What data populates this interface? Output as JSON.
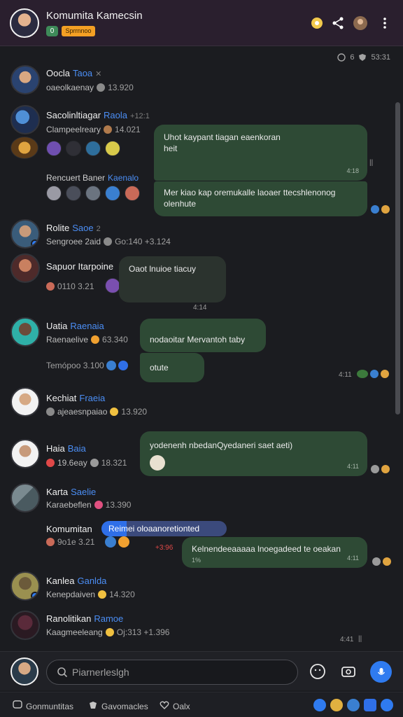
{
  "header": {
    "title": "Komumita Kamecsin",
    "level": "0",
    "badge": "Sprrnnoo"
  },
  "status": {
    "time": "53:31",
    "glyphs": "6"
  },
  "messages": [
    {
      "name": "Oocla",
      "role": "Taoa",
      "extra": "✕",
      "meta_text": "oaeolkaenay",
      "meta_num": "13.920"
    },
    {
      "name": "Sacolinltiagar",
      "role": "Raola",
      "extra": "+12:1",
      "meta_text": "Clampeelreary",
      "meta_num": "14.021"
    },
    {
      "name": "Rolite",
      "role": "Saoe",
      "extra": "2",
      "meta_text": "Sengroee 2aid",
      "meta_num": "Go:140 +3.124"
    },
    {
      "name": "Sapuor Itarpoine",
      "role": "",
      "extra": "",
      "meta_text": "",
      "meta_num": "0110 3.21"
    },
    {
      "name": "Uatia",
      "role": "Raenaia",
      "extra": "",
      "meta_text": "Raenaelive",
      "meta_num": "63.340"
    },
    {
      "name": "Kechiat",
      "role": "Fraeia",
      "extra": "",
      "meta_text": "ajeaesnpaiao",
      "meta_num": "13.920"
    },
    {
      "name": "Haia",
      "role": "Baia",
      "extra": "",
      "meta_text": "19.6eay",
      "meta_num": "18.321"
    },
    {
      "name": "Karta",
      "role": "Saelie",
      "extra": "",
      "meta_text": "Karaebeflen",
      "meta_num": "13.390"
    },
    {
      "name": "Komumitan",
      "role": "",
      "extra": "",
      "meta_text": "",
      "meta_num": "9o1e 3.21"
    },
    {
      "name": "Kanlea",
      "role": "Ganlda",
      "extra": "",
      "meta_text": "Kenepdaiven",
      "meta_num": "14.320"
    },
    {
      "name": "Ranolitikan",
      "role": "Ramoe",
      "extra": "",
      "meta_text": "Kaagmeeleang",
      "meta_num": "Oj:313 +1.396"
    }
  ],
  "sub_label": "Rencuert Baner",
  "sub_role": "Kaenalo",
  "bubbles": {
    "b1_text": "Uhot kaypant tiagan eaenkoran",
    "b1_text2": "heit",
    "b1_time": "4:18",
    "b2_text": "Mer kiao kap oremukalle laoaer ttecshlenonog",
    "b2_text2": "olenhute",
    "b3_text": "Oaot lnuioe tiacuy",
    "b3_time": "4:14",
    "b4_text": "nodaoitar Mervantoh taby",
    "b5_text": "otute",
    "b5_time": "4:11",
    "b6_text": "yodenenh nbedanQyedaneri saet aeti)",
    "b6_time": "4:11",
    "pill_text": "Reimei oloaanoretionted",
    "b7_text": "Kelnendeeaaaaa lnoegadeed te oeakan",
    "b7_text2": "1%",
    "b7_time": "4:11",
    "b7_left": "+3:96",
    "last_time": "4:41"
  },
  "composer": {
    "placeholder": "Piarnerleslgh"
  },
  "bottom_nav": [
    "Gonmuntitas",
    "Gavomacles",
    "Oalx"
  ],
  "colors": {
    "header_bg": "#2a1f2e",
    "bubble_green": "#2e4a35",
    "accent_blue": "#2f7bf0",
    "badge_orange": "#f4a024",
    "level_green": "#3e8a59"
  }
}
